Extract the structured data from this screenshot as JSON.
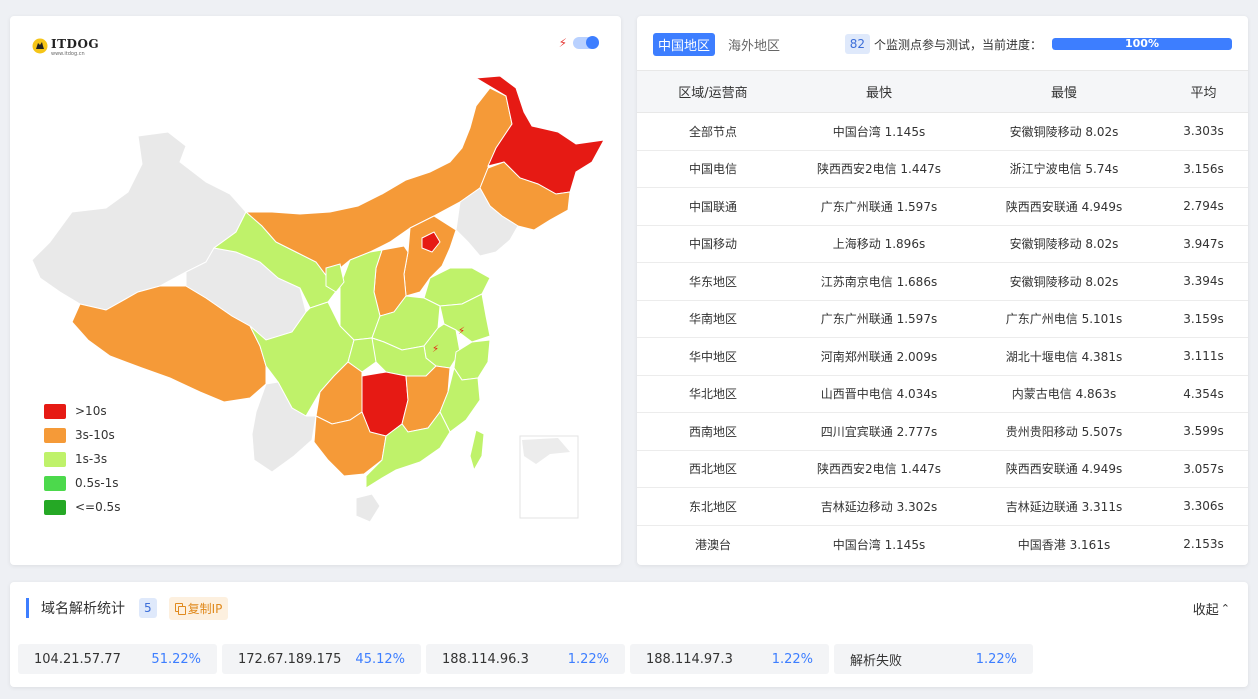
{
  "map": {
    "logo_text": "ITDOG",
    "logo_subtext": "www.itdog.cn",
    "legend": [
      {
        "label": ">10s",
        "color": "#e61a14"
      },
      {
        "label": "3s-10s",
        "color": "#f59a38"
      },
      {
        "label": "1s-3s",
        "color": "#bff26a"
      },
      {
        "label": "0.5s-1s",
        "color": "#4cd94c"
      },
      {
        "label": "<=0.5s",
        "color": "#25a825"
      }
    ],
    "colors": {
      "none": "#e9e9e9",
      "red": "#e61a14",
      "orange": "#f59a38",
      "lightgreen": "#bff26a"
    }
  },
  "tabs": [
    {
      "label": "中国地区"
    },
    {
      "label": "海外地区"
    }
  ],
  "progress": {
    "count": "82",
    "text": "个监测点参与测试，当前进度：",
    "value": 1.0,
    "label": "100%"
  },
  "table": {
    "headers": [
      "区域/运营商",
      "最快",
      "最慢",
      "平均"
    ],
    "rows": [
      [
        "全部节点",
        "中国台湾 1.145s",
        "安徽铜陵移动 8.02s",
        "3.303s"
      ],
      [
        "中国电信",
        "陕西西安2电信 1.447s",
        "浙江宁波电信 5.74s",
        "3.156s"
      ],
      [
        "中国联通",
        "广东广州联通 1.597s",
        "陕西西安联通 4.949s",
        "2.794s"
      ],
      [
        "中国移动",
        "上海移动 1.896s",
        "安徽铜陵移动 8.02s",
        "3.947s"
      ],
      [
        "华东地区",
        "江苏南京电信 1.686s",
        "安徽铜陵移动 8.02s",
        "3.394s"
      ],
      [
        "华南地区",
        "广东广州联通 1.597s",
        "广东广州电信 5.101s",
        "3.159s"
      ],
      [
        "华中地区",
        "河南郑州联通 2.009s",
        "湖北十堰电信 4.381s",
        "3.111s"
      ],
      [
        "华北地区",
        "山西晋中电信 4.034s",
        "内蒙古电信 4.863s",
        "4.354s"
      ],
      [
        "西南地区",
        "四川宜宾联通 2.777s",
        "贵州贵阳移动 5.507s",
        "3.599s"
      ],
      [
        "西北地区",
        "陕西西安2电信 1.447s",
        "陕西西安联通 4.949s",
        "3.057s"
      ],
      [
        "东北地区",
        "吉林延边移动 3.302s",
        "吉林延边联通 3.311s",
        "3.306s"
      ],
      [
        "港澳台",
        "中国台湾 1.145s",
        "中国香港 3.161s",
        "2.153s"
      ]
    ]
  },
  "dns": {
    "title": "域名解析统计",
    "count": "5",
    "copy_label": "复制IP",
    "collapse_label": "收起",
    "items": [
      {
        "ip": "104.21.57.77",
        "pct": "51.22%"
      },
      {
        "ip": "172.67.189.175",
        "pct": "45.12%"
      },
      {
        "ip": "188.114.96.3",
        "pct": "1.22%"
      },
      {
        "ip": "188.114.97.3",
        "pct": "1.22%"
      },
      {
        "ip": "解析失败",
        "pct": "1.22%"
      }
    ]
  }
}
